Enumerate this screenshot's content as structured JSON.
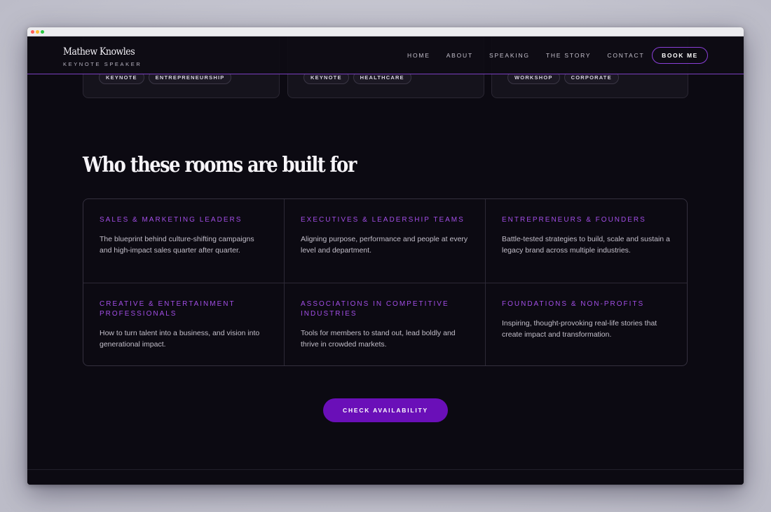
{
  "header": {
    "brand_name": "Mathew Knowles",
    "brand_sub": "KEYNOTE SPEAKER",
    "nav": [
      "HOME",
      "ABOUT",
      "SPEAKING",
      "THE STORY",
      "CONTACT"
    ],
    "book_label": "BOOK ME"
  },
  "top_cards": [
    {
      "tags": [
        "KEYNOTE",
        "ENTREPRENEURSHIP"
      ]
    },
    {
      "tags": [
        "KEYNOTE",
        "HEALTHCARE"
      ]
    },
    {
      "tags": [
        "WORKSHOP",
        "CORPORATE"
      ]
    }
  ],
  "section": {
    "title": "Who these rooms are built for"
  },
  "audiences": [
    {
      "title": "SALES & MARKETING LEADERS",
      "body": "The blueprint behind culture-shifting campaigns and high-impact sales quarter after quarter."
    },
    {
      "title": "EXECUTIVES & LEADERSHIP TEAMS",
      "body": "Aligning purpose, performance and people at every level and department."
    },
    {
      "title": "ENTREPRENEURS & FOUNDERS",
      "body": "Battle-tested strategies to build, scale and sustain a legacy brand across multiple industries."
    },
    {
      "title": "CREATIVE & ENTERTAINMENT PROFESSIONALS",
      "body": "How to turn talent into a business, and vision into generational impact."
    },
    {
      "title": "ASSOCIATIONS IN COMPETITIVE INDUSTRIES",
      "body": "Tools for members to stand out, lead boldly and thrive in crowded markets."
    },
    {
      "title": "FOUNDATIONS & NON-PROFITS",
      "body": "Inspiring, thought-provoking real-life stories that create impact and transformation."
    }
  ],
  "cta": {
    "label": "CHECK AVAILABILITY"
  },
  "colors": {
    "accent": "#a24ee6",
    "button": "#6a0fb8",
    "background": "#0c0a12"
  }
}
